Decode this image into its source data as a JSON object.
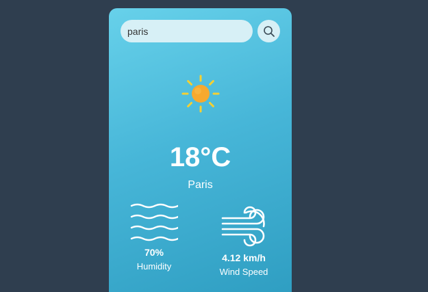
{
  "search": {
    "value": "paris",
    "icon": "search-icon"
  },
  "weather": {
    "icon": "sun-icon",
    "temperature": "18°C",
    "city": "Paris"
  },
  "humidity": {
    "icon": "humidity-waves-icon",
    "value": "70%",
    "label": "Humidity"
  },
  "wind": {
    "icon": "wind-icon",
    "value": "4.12 km/h",
    "label": "Wind Speed"
  },
  "colors": {
    "background": "#2f3e4f",
    "card_top": "#67d1ea",
    "card_bottom": "#2e9dc1",
    "sun": "#f7a92e",
    "sun_rays": "#f5d032"
  }
}
